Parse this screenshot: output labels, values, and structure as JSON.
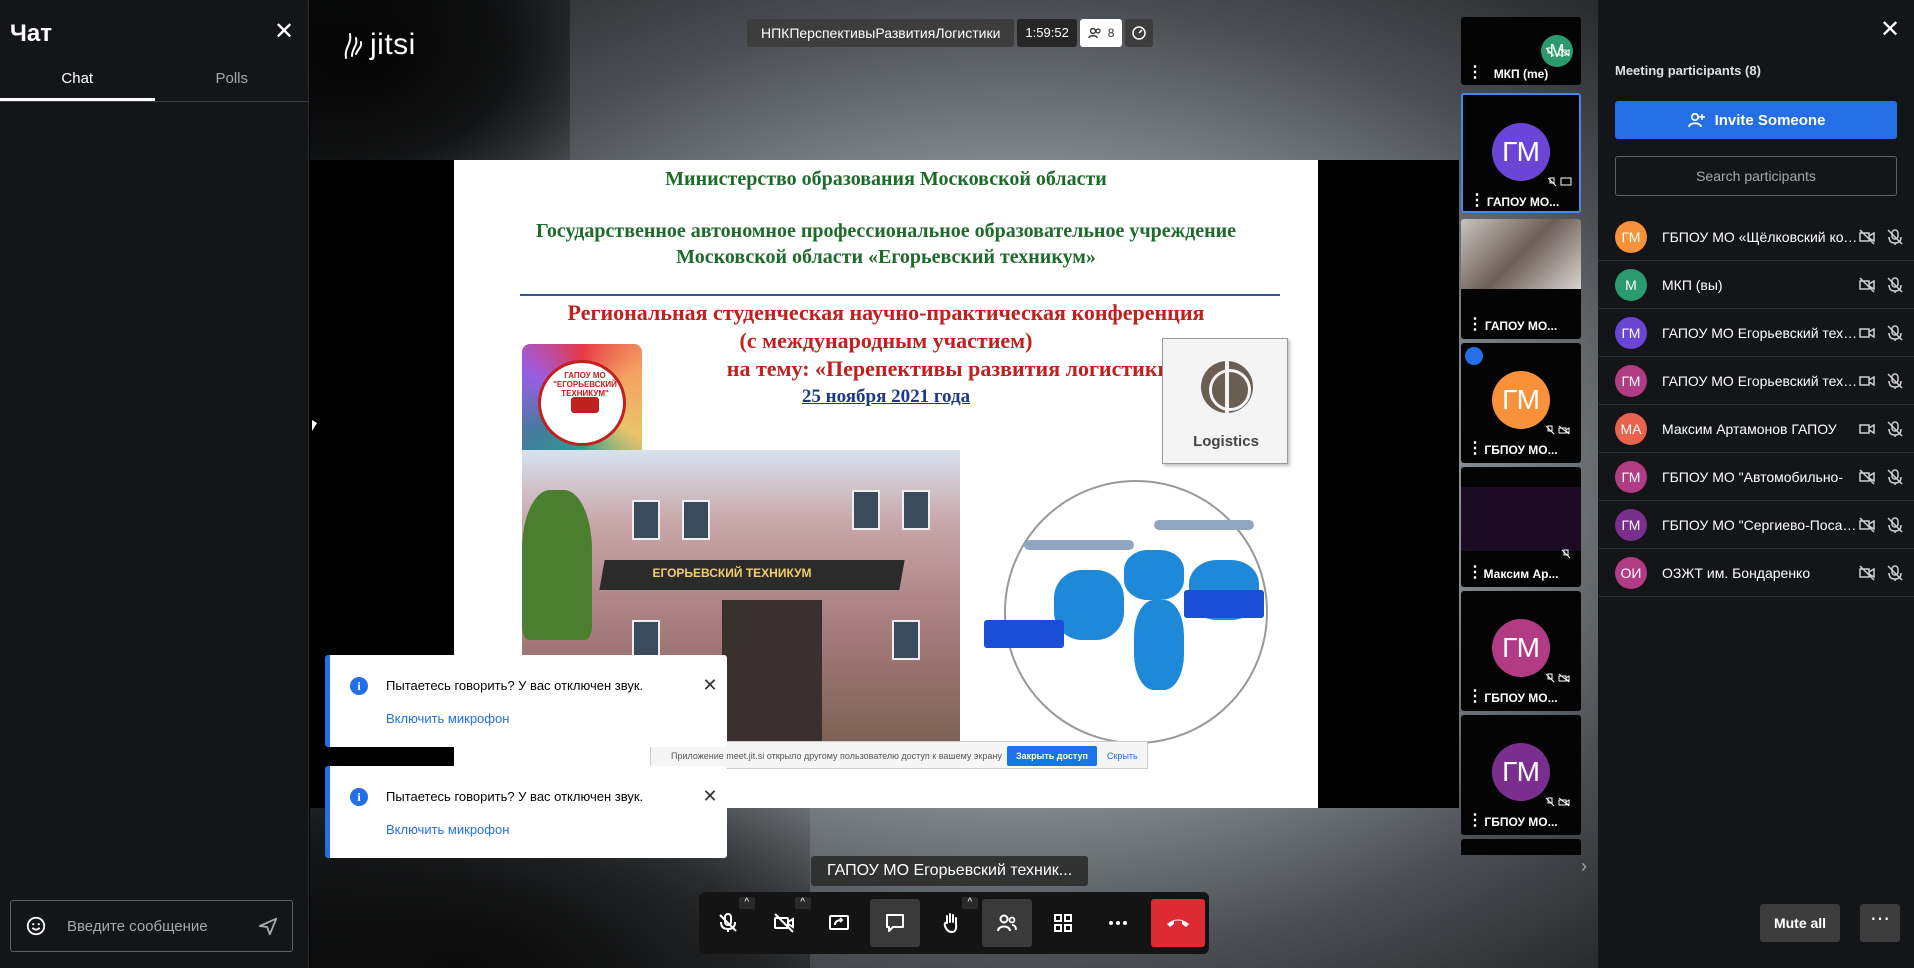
{
  "chat": {
    "title": "Чат",
    "tabs": [
      "Chat",
      "Polls"
    ],
    "input_placeholder": "Введите сообщение"
  },
  "app": {
    "logo": "jitsi"
  },
  "header": {
    "meeting_name": "НПКПерспективыРазвитияЛогистики",
    "timer": "1:59:52",
    "participant_count": "8"
  },
  "slide": {
    "ministry": "Министерство образования Московской области",
    "institution_1": "Государственное автономное профессиональное образовательное учреждение",
    "institution_2": "Московской области  «Егорьевский техникум»",
    "conf_1": "Региональная  студенческая научно-практическая конференция",
    "conf_2": "(с международным участием)",
    "conf_3": "на тему: «Перепективы развития логистики»",
    "date": "25 ноября 2021 года",
    "badge_text": "ГАПОУ МО \"ЕГОРЬЕВСКИЙ ТЕХНИКУМ\"",
    "logistics_label": "Logistics",
    "building_sign": "ЕГОРЬЕВСКИЙ ТЕХНИКУМ",
    "share_msg": "Приложение meet.jit.si открыло другому пользователю доступ к вашему экрану",
    "share_stop": "Закрыть доступ",
    "share_hide": "Скрыть"
  },
  "notifications": [
    {
      "title": "Пытаетесь говорить? У вас отключен звук.",
      "action": "Включить микрофон"
    },
    {
      "title": "Пытаетесь говорить? У вас отключен звук.",
      "action": "Включить микрофон"
    }
  ],
  "dominant_speaker": "ГАПОУ МО Егорьевский техник...",
  "filmstrip": [
    {
      "initials": "М",
      "name": "МКП (me)",
      "color": "#2b9b6f"
    },
    {
      "initials": "ГМ",
      "name": "ГАПОУ МО...",
      "color": "#6a46d6"
    },
    {
      "initials": "",
      "name": "ГАПОУ МО...",
      "color": "#8d8d8d"
    },
    {
      "initials": "ГМ",
      "name": "ГБПОУ МО...",
      "color": "#f7923a"
    },
    {
      "initials": "",
      "name": "Максим Ар...",
      "color": "#1b0c24"
    },
    {
      "initials": "ГМ",
      "name": "ГБПОУ МО...",
      "color": "#b23b86"
    },
    {
      "initials": "ГМ",
      "name": "ГБПОУ МО...",
      "color": "#7a2f8e"
    }
  ],
  "participants_panel": {
    "title": "Meeting participants (8)",
    "invite_label": "Invite Someone",
    "search_placeholder": "Search participants",
    "mute_all_label": "Mute all",
    "more_label": "⋯",
    "list": [
      {
        "initials": "ГМ",
        "name": "ГБПОУ МО «Щёлковский колледж»",
        "color": "#f7923a",
        "video": "off"
      },
      {
        "initials": "М",
        "name": "МКП (вы)",
        "color": "#2b9b6f",
        "video": "off"
      },
      {
        "initials": "ГМ",
        "name": "ГАПОУ МО Егорьевский техникум",
        "color": "#6a46d6",
        "video": "on"
      },
      {
        "initials": "ГМ",
        "name": "ГАПОУ МО Егорьевский техникум",
        "color": "#b23b86",
        "video": "on"
      },
      {
        "initials": "МА",
        "name": "Максим Артамонов ГАПОУ",
        "color": "#e9624b",
        "video": "on"
      },
      {
        "initials": "ГМ",
        "name": "ГБПОУ МО \"Автомобильно-",
        "color": "#b23b86",
        "video": "off"
      },
      {
        "initials": "ГМ",
        "name": "ГБПОУ МО \"Сергиево-Посадский",
        "color": "#7a2f8e",
        "video": "off"
      },
      {
        "initials": "ОИ",
        "name": "ОЗЖТ им. Бондаренко",
        "color": "#b23b86",
        "video": "off"
      }
    ]
  },
  "colors": {
    "accent": "#246fe5",
    "hangup": "#dd2a33",
    "panel_bg": "#131519"
  }
}
